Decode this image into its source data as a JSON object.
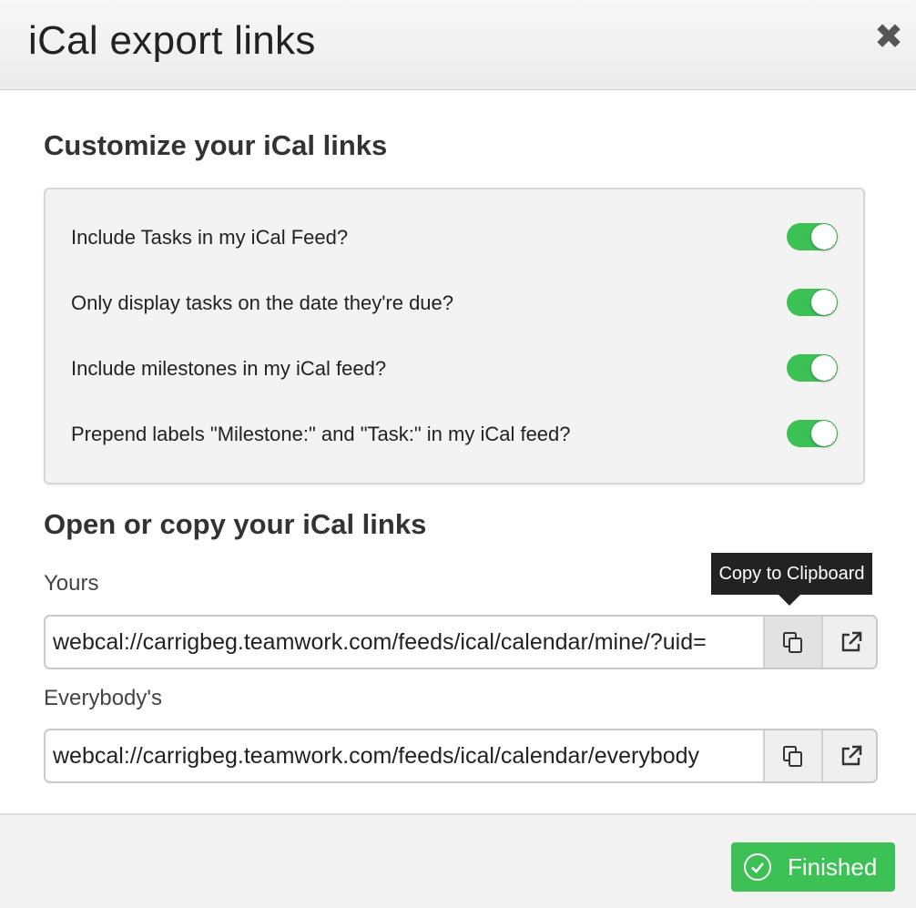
{
  "header": {
    "title": "iCal export links",
    "close_symbol": "✖"
  },
  "customize": {
    "title": "Customize your iCal links",
    "options": [
      {
        "label": "Include Tasks in my iCal Feed?",
        "enabled": true
      },
      {
        "label": "Only display tasks on the date they're due?",
        "enabled": true
      },
      {
        "label": "Include milestones in my iCal feed?",
        "enabled": true
      },
      {
        "label": "Prepend labels \"Milestone:\" and \"Task:\" in my iCal feed?",
        "enabled": true
      }
    ]
  },
  "links": {
    "title": "Open or copy your iCal links",
    "yours": {
      "label": "Yours",
      "value": "webcal://carrigbeg.teamwork.com/feeds/ical/calendar/mine/?uid="
    },
    "everybody": {
      "label": "Everybody's",
      "value": "webcal://carrigbeg.teamwork.com/feeds/ical/calendar/everybody"
    },
    "tooltip": "Copy to Clipboard"
  },
  "footer": {
    "finished_label": "Finished"
  },
  "colors": {
    "accent_green": "#3cc154",
    "tooltip_bg": "#222222"
  },
  "icons": {
    "copy": "copy-icon",
    "open": "external-link-icon",
    "close": "close-icon",
    "check": "check-circle-icon"
  }
}
